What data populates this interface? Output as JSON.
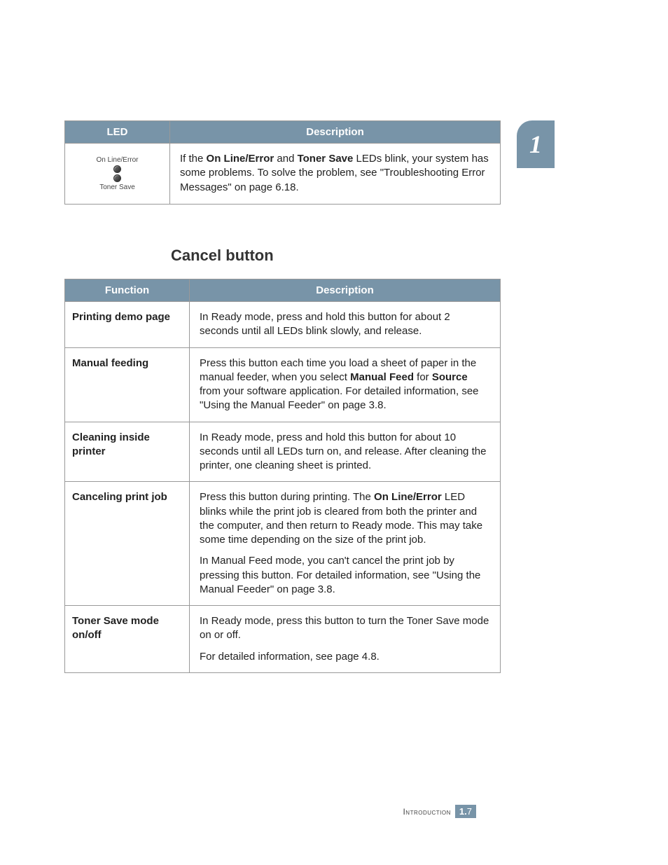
{
  "chapter_number": "1",
  "table1": {
    "headers": [
      "LED",
      "Description"
    ],
    "led_labels": {
      "line1": "On Line/Error",
      "line2": "Toner Save"
    },
    "desc": {
      "pre": "If the ",
      "bold1": "On Line/Error",
      "mid1": " and ",
      "bold2": "Toner Save",
      "post": " LEDs blink, your system has some problems. To solve the problem, see \"Troubleshooting Error Messages\" on page 6.18."
    }
  },
  "section_heading": "Cancel button",
  "table2": {
    "headers": [
      "Function",
      "Description"
    ],
    "rows": [
      {
        "fn": "Printing demo page",
        "paras": [
          {
            "segments": [
              {
                "t": "In Ready mode, press and hold this button for about 2 seconds until all LEDs blink slowly, and release."
              }
            ]
          }
        ]
      },
      {
        "fn": "Manual feeding",
        "paras": [
          {
            "segments": [
              {
                "t": "Press this button each time you load a sheet of paper in the manual feeder, when you select "
              },
              {
                "t": "Manual Feed",
                "b": true
              },
              {
                "t": " for "
              },
              {
                "t": "Source",
                "b": true
              },
              {
                "t": " from your software application. For detailed information, see \"Using the Manual Feeder\" on page 3.8."
              }
            ]
          }
        ]
      },
      {
        "fn": "Cleaning inside printer",
        "paras": [
          {
            "segments": [
              {
                "t": "In Ready mode, press and hold this button for about 10 seconds until all LEDs turn on, and release. After cleaning the printer, one cleaning sheet is printed."
              }
            ]
          }
        ]
      },
      {
        "fn": "Canceling print job",
        "paras": [
          {
            "segments": [
              {
                "t": "Press this button during printing. The "
              },
              {
                "t": "On Line/Error",
                "b": true
              },
              {
                "t": " LED blinks while the print job is cleared from both the printer and the computer, and then return to Ready mode. This may take some time depending on the size of the print job."
              }
            ]
          },
          {
            "segments": [
              {
                "t": "In Manual Feed mode, you can't cancel the print job by pressing this button. For detailed information, see \"Using the Manual Feeder\" on page 3.8."
              }
            ]
          }
        ]
      },
      {
        "fn": "Toner Save mode on/off",
        "paras": [
          {
            "segments": [
              {
                "t": "In Ready mode, press this button to turn the Toner Save mode on or off."
              }
            ]
          },
          {
            "segments": [
              {
                "t": "For detailed information, see page 4.8."
              }
            ]
          }
        ]
      }
    ]
  },
  "footer": {
    "section": "Introduction",
    "page_major": "1.",
    "page_minor": "7"
  }
}
